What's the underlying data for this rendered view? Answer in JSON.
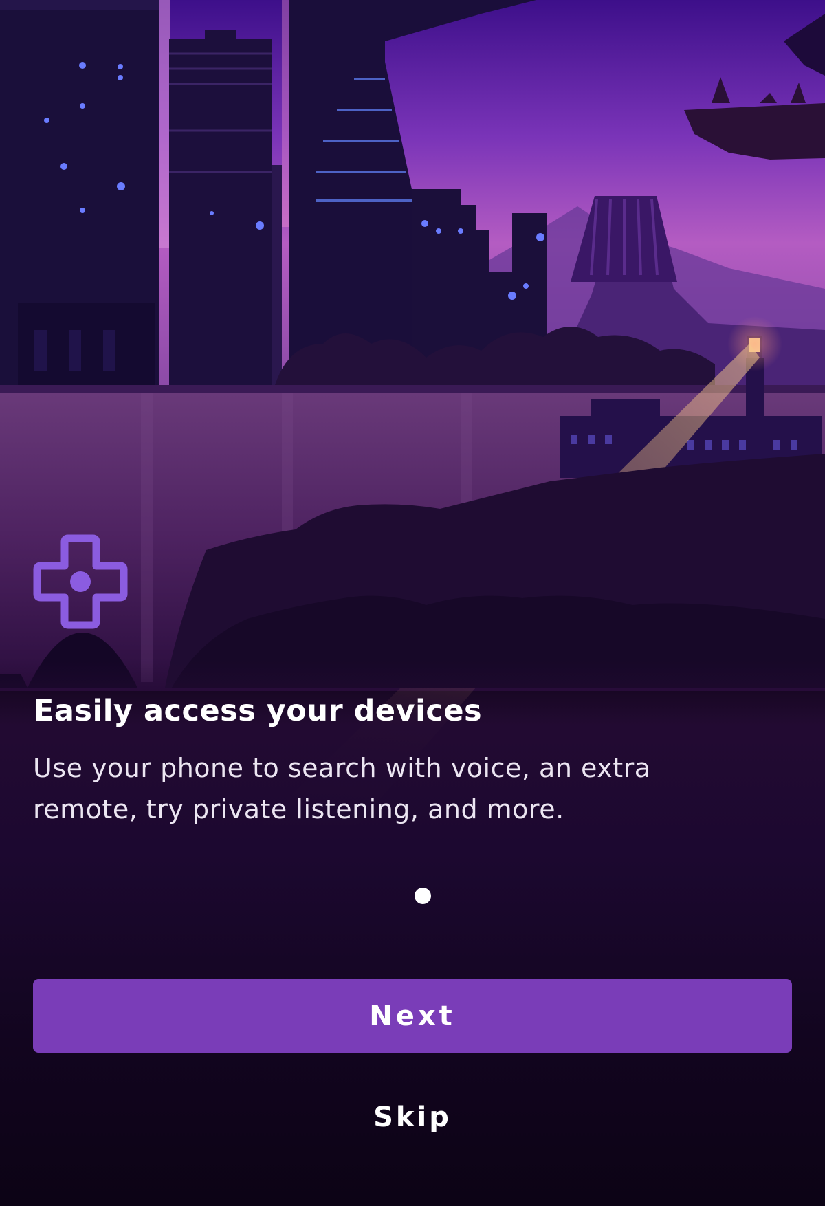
{
  "onboarding": {
    "illustration": "night-city-skyline-lighthouse",
    "icon": "dpad-icon",
    "title": "Easily access your devices",
    "description": "Use your phone to search with voice, an extra remote, try private listening, and more.",
    "pager": {
      "total": 1,
      "current": 1
    },
    "next_label": "Next",
    "skip_label": "Skip"
  },
  "colors": {
    "accent": "#7a3db8",
    "icon": "#8b5ce0",
    "background": "#0f0418",
    "text": "#ffffff"
  }
}
